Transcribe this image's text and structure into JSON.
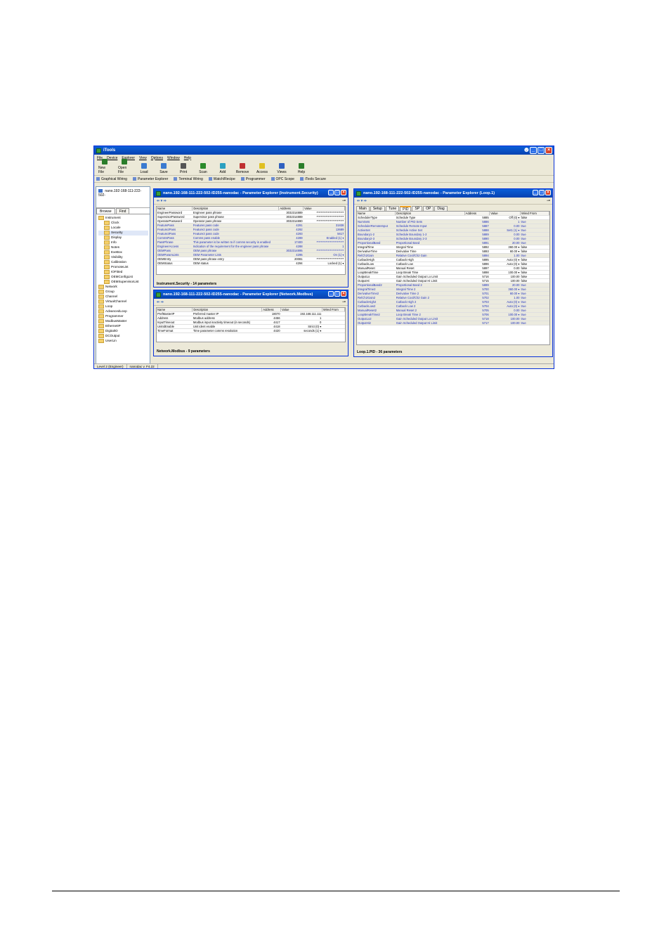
{
  "app": {
    "title": "iTools"
  },
  "menu": [
    "File",
    "Device",
    "Explorer",
    "View",
    "Options",
    "Window",
    "Help"
  ],
  "toolbar": [
    "New File",
    "Open File",
    "Load",
    "Save",
    "Print",
    "Scan",
    "Add",
    "Remove",
    "Access",
    "Views",
    "Help"
  ],
  "toolbar2": [
    "Graphical Wiring",
    "Parameter Explorer",
    "Terminal Wiring",
    "Watch/Recipe",
    "Programmer",
    "OPC Scope",
    "iTools Secure"
  ],
  "left": {
    "device": "nano.192-168-111-222-502-",
    "tabs": [
      "Browse",
      "Find"
    ],
    "tree": [
      {
        "label": "Instrument",
        "child": false
      },
      {
        "label": "Clock",
        "child": true
      },
      {
        "label": "Locale",
        "child": true
      },
      {
        "label": "Security",
        "child": true,
        "sel": true
      },
      {
        "label": "Display",
        "child": true
      },
      {
        "label": "Info",
        "child": true
      },
      {
        "label": "Notes",
        "child": true
      },
      {
        "label": "ExeBox",
        "child": true
      },
      {
        "label": "Visibility",
        "child": true
      },
      {
        "label": "Calibration",
        "child": true
      },
      {
        "label": "PromoteList",
        "child": true
      },
      {
        "label": "IOFitted",
        "child": true
      },
      {
        "label": "OEMConfigList",
        "child": true
      },
      {
        "label": "OEMSupervisorList",
        "child": true
      },
      {
        "label": "Network",
        "child": false
      },
      {
        "label": "Group",
        "child": false
      },
      {
        "label": "Channel",
        "child": false
      },
      {
        "label": "VirtualChannel",
        "child": false
      },
      {
        "label": "Loop",
        "child": false
      },
      {
        "label": "AdvancedLoop",
        "child": false
      },
      {
        "label": "Programmer",
        "child": false
      },
      {
        "label": "ModbusMaster",
        "child": false
      },
      {
        "label": "EthernetIP",
        "child": false
      },
      {
        "label": "DigitalIO",
        "child": false
      },
      {
        "label": "DCOutput",
        "child": false
      },
      {
        "label": "UserLin",
        "child": false
      }
    ]
  },
  "security": {
    "title": "nano.192-168-111-222-502-ID255-nanodac - Parameter Explorer (Instrument.Security)",
    "headers": [
      "Name",
      "Description",
      "Address",
      "Value"
    ],
    "rows": [
      [
        "EngineerPassword",
        "Engineer pass phrase",
        "3032314889",
        "************************",
        false
      ],
      [
        "SupervisorPassword",
        "Supervisor pass phrase",
        "3032314889",
        "************************",
        false
      ],
      [
        "OperatorPassword",
        "Operator pass phrase",
        "3032314890",
        "************************",
        false
      ],
      [
        "FeaturePass",
        "Features pass code",
        "4291",
        "31838",
        true
      ],
      [
        "Feature2Pass",
        "Feature2 pass code",
        "4292",
        "13689",
        true
      ],
      [
        "Feature3Pass",
        "Feature3 pass code",
        "4293",
        "5617",
        true
      ],
      [
        "CommsPass",
        "Comms pass enable",
        "4289",
        "Enabled (1) ▾",
        true
      ],
      [
        "PassPhrase",
        "This parameter is be written to if comms security is enabled",
        "17400",
        "************************",
        true
      ],
      [
        "EngineerAccess",
        "Indication of the requirement for the engineer pass phrase",
        "4288",
        "1",
        true
      ],
      [
        "OEMPass",
        "OEM pass phrase",
        "3032314895",
        "************************",
        true
      ],
      [
        "OEMParamLists",
        "OEM Parameter Lists",
        "4295",
        "On (1) ▾",
        true
      ],
      [
        "OEMEntry",
        "OEM pass phrase entry",
        "20081",
        "************************",
        false
      ],
      [
        "OEMStatus",
        "OEM status",
        "4294",
        "Locked (1) ▾",
        false
      ]
    ],
    "status": "Instrument.Security  -  14 parameters"
  },
  "modbus": {
    "title": "nano.192-168-111-222-502-ID255-nanodac - Parameter Explorer (Network.Modbus)",
    "headers": [
      "Name",
      "Description",
      "Address",
      "Value",
      "Wired From"
    ],
    "rows": [
      [
        "PrefMasterIP",
        "Preferred master IP",
        "18070",
        "192.168.111.111",
        ""
      ],
      [
        "Address",
        "Modbus address",
        "4456",
        "1",
        ""
      ],
      [
        "InputTimeout",
        "Modbus input inactivity timeout (in seconds)",
        "4417",
        "0",
        ""
      ],
      [
        "UnitIdEnable",
        "Unit ident enable",
        "4418",
        "Strict (0) ▾",
        ""
      ],
      [
        "TimeFormat",
        "Time parameter comms resolution",
        "4420",
        "seconds (1) ▾",
        ""
      ]
    ],
    "status": "Network.Modbus  -  9 parameters"
  },
  "loop": {
    "title": "nano.192-168-111-222-502-ID255-nanodac - Parameter Explorer (Loop.1)",
    "tabs": [
      "Main",
      "Setup",
      "Tune",
      "PID",
      "SP",
      "OP",
      "Diag"
    ],
    "headers": [
      "Name",
      "Description",
      "Address",
      "Value",
      "Wired From"
    ],
    "rows": [
      [
        "SchedulerType",
        "Schedule Type",
        "5885",
        "Off (0) ▾",
        false
      ],
      [
        "NumSets",
        "Number of PID Sets",
        "5886",
        "1",
        true
      ],
      [
        "SchedulerRemoteInput",
        "Schedule Remote Input",
        "5887",
        "0.00",
        true
      ],
      [
        "ActiveSet",
        "Schedule Active Set",
        "5888",
        "Set1 (1) ▾",
        true
      ],
      [
        "Boundary1-2",
        "Schedule Boundary 1-2",
        "5889",
        "0.00",
        true
      ],
      [
        "Boundary2-3",
        "Schedule Boundary 2-3",
        "5890",
        "0.00",
        true
      ],
      [
        "ProportionalBand",
        "Proportional Band",
        "5891",
        "20.00",
        true
      ],
      [
        "IntegralTime",
        "Integral Time",
        "5892",
        "360.00 ▾",
        false
      ],
      [
        "DerivativeTime",
        "Derivative Time",
        "5893",
        "60.00 ▾",
        false
      ],
      [
        "RelCh2Gain",
        "Relative Cool/Ch2 Gain",
        "5894",
        "1.00",
        true
      ],
      [
        "CutbackHigh",
        "Cutback High",
        "5895",
        "Auto (0) ▾",
        false
      ],
      [
        "CutbackLow",
        "Cutback Low",
        "5896",
        "Auto (0) ▾",
        false
      ],
      [
        "ManualReset",
        "Manual Reset",
        "5897",
        "0.00",
        false
      ],
      [
        "LoopBreakTime",
        "Loop Break Time",
        "5898",
        "100.00 ▾",
        false
      ],
      [
        "OutputLo",
        "Gain Scheduled Output Lo Limit",
        "5716",
        "100.00",
        false
      ],
      [
        "OutputHi",
        "Gain Scheduled Output Hi Limit",
        "5715",
        "100.00",
        false
      ],
      [
        "ProportionalBand2",
        "Proportional Band 2",
        "5899",
        "20.00",
        true
      ],
      [
        "IntegralTime2",
        "Integral Time 2",
        "5700",
        "360.00 ▾",
        true
      ],
      [
        "DerivativeTime2",
        "Derivative Time 2",
        "5701",
        "60.00 ▾",
        true
      ],
      [
        "RelCh2Gain2",
        "Relative Cool/Ch2 Gain 2",
        "5702",
        "1.00",
        true
      ],
      [
        "CutbackHigh2",
        "Cutback High 2",
        "5703",
        "Auto (0) ▾",
        true
      ],
      [
        "CutbackLow2",
        "Cutback Low 2",
        "5704",
        "Auto (0) ▾",
        true
      ],
      [
        "ManualReset2",
        "Manual Reset 2",
        "5705",
        "0.00",
        true
      ],
      [
        "LoopBreakTime2",
        "Loop Break Time 2",
        "5706",
        "100.00 ▾",
        true
      ],
      [
        "OutputLo2",
        "Gain Scheduled Output Lo Limit",
        "5718",
        "100.00",
        true
      ],
      [
        "OutputHi2",
        "Gain Scheduled Output Hi Limit",
        "5717",
        "100.00",
        true
      ]
    ],
    "status": "Loop.1.PID  -  36 parameters"
  },
  "statusbar": [
    "Level 2 (Engineer)",
    "nanodac v. F4.22"
  ]
}
